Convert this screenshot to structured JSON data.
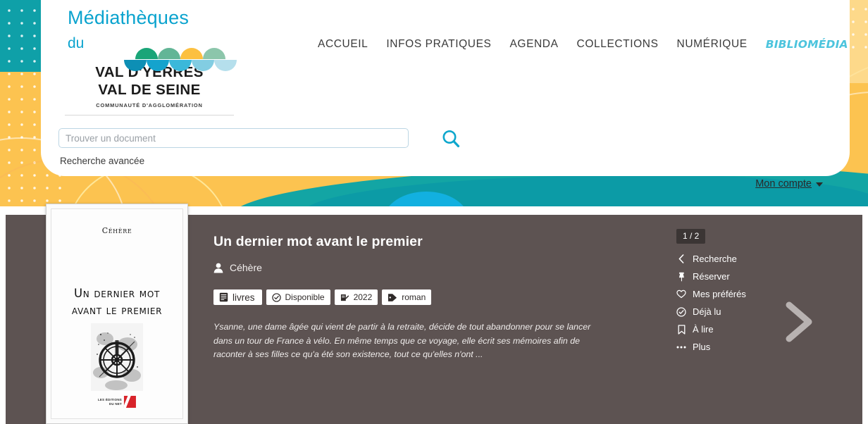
{
  "site": {
    "logo": {
      "line1": "Médiathèques",
      "line2": "du",
      "name_line1": "VAL D'YERRES",
      "name_line2": "VAL DE SEINE",
      "subtitle": "COMMUNAUTÉ D'AGGLOMÉRATION",
      "semicircle_top_colors": [
        "#1aa578",
        "#62b596",
        "#fcc040",
        "#8cc6ab",
        "#ffffff"
      ],
      "semicircle_bottom_colors": [
        "#0d8fb5",
        "#14a3cd",
        "#3bb8da",
        "#82cde2",
        "#b5dfec"
      ],
      "title_color": "#0aa3ce"
    },
    "nav": [
      {
        "label": "ACCUEIL",
        "highlight": false
      },
      {
        "label": "INFOS PRATIQUES",
        "highlight": false
      },
      {
        "label": "AGENDA",
        "highlight": false
      },
      {
        "label": "COLLECTIONS",
        "highlight": false
      },
      {
        "label": "NUMÉRIQUE",
        "highlight": false
      },
      {
        "label": "BIBLIOMÉDIA",
        "highlight": true
      }
    ],
    "search": {
      "placeholder": "Trouver un document",
      "value": "",
      "button_icon": "search-icon",
      "advanced_label": "Recherche avancée"
    },
    "account": {
      "label": "Mon compte",
      "icon": "chevron-down-icon"
    },
    "colors": {
      "teal": "#13a5a4",
      "yellow": "#fcc350",
      "cyan": "#0aa3ce",
      "bibliomedia": "#4cc4dd",
      "content_bg": "#5d5352",
      "badge_dark": "#3b3534"
    }
  },
  "record": {
    "title": "Un dernier mot avant le premier",
    "author": "Céhère",
    "author_icon": "user-icon",
    "badges": [
      {
        "label": "livres",
        "icon": "book-icon"
      },
      {
        "label": "Disponible",
        "icon": "check-circle-icon"
      },
      {
        "label": "2022",
        "icon": "edit-document-icon"
      },
      {
        "label": "roman",
        "icon": "tag-icon"
      }
    ],
    "description": "Ysanne, une dame âgée qui vient de partir à la retraite, décide de tout abandonner pour se lancer dans un tour de France à vélo. En même temps que ce voyage, elle écrit ses mémoires afin de raconter à ses filles ce qu'a été son existence, tout ce qu'elles n'ont ...",
    "cover": {
      "author": "Céhère",
      "title_line1": "Un dernier mot",
      "title_line2": "avant le premier",
      "publisher_line1": "LES ÉDITIONS",
      "publisher_line2": "DU NET"
    }
  },
  "actions": {
    "pager": "1 / 2",
    "items": [
      {
        "label": "Recherche",
        "icon": "chevron-left-icon"
      },
      {
        "label": "Réserver",
        "icon": "pin-icon"
      },
      {
        "label": "Mes préférés",
        "icon": "heart-icon"
      },
      {
        "label": "Déjà lu",
        "icon": "check-circle-icon"
      },
      {
        "label": "À lire",
        "icon": "bookmark-icon"
      },
      {
        "label": "Plus",
        "icon": "ellipsis-icon"
      }
    ],
    "next_icon": "chevron-right-icon"
  }
}
